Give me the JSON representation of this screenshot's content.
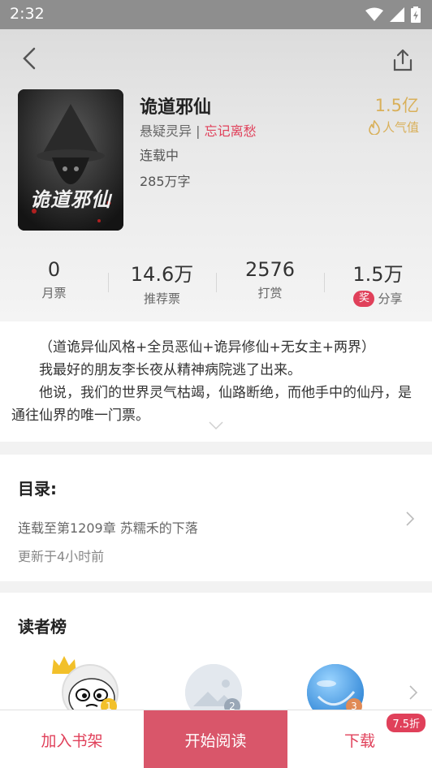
{
  "status_bar": {
    "time": "2:32"
  },
  "book": {
    "title": "诡道邪仙",
    "genre": "悬疑灵异",
    "separator": "|",
    "author": "忘记离愁",
    "status": "连载中",
    "word_count": "285万字",
    "popularity_value": "1.5亿",
    "popularity_label": "人气值",
    "cover_text": "诡道邪仙"
  },
  "stats": [
    {
      "value": "0",
      "label": "月票"
    },
    {
      "value": "14.6万",
      "label": "推荐票"
    },
    {
      "value": "2576",
      "label": "打赏"
    },
    {
      "value": "1.5万",
      "label": "分享",
      "badge": "奖"
    }
  ],
  "description": {
    "lines": [
      "（道诡异仙风格+全员恶仙+诡异修仙+无女主+两界）",
      "我最好的朋友李长夜从精神病院逃了出来。",
      "他说，我们的世界灵气枯竭，仙路断绝，而他手中的仙丹，是通往仙界的唯一门票。"
    ]
  },
  "toc": {
    "heading": "目录:",
    "latest": "连载至第1209章 苏糯禾的下落",
    "updated": "更新于4小时前"
  },
  "readers": {
    "heading": "读者榜",
    "ranks": [
      "1",
      "2",
      "3"
    ]
  },
  "bottom_bar": {
    "add_label": "加入书架",
    "read_label": "开始阅读",
    "download_label": "下载",
    "discount": "7.5折"
  },
  "colors": {
    "accent": "#e0405a",
    "read_button": "#d9566a",
    "popularity": "#d9b05a"
  }
}
